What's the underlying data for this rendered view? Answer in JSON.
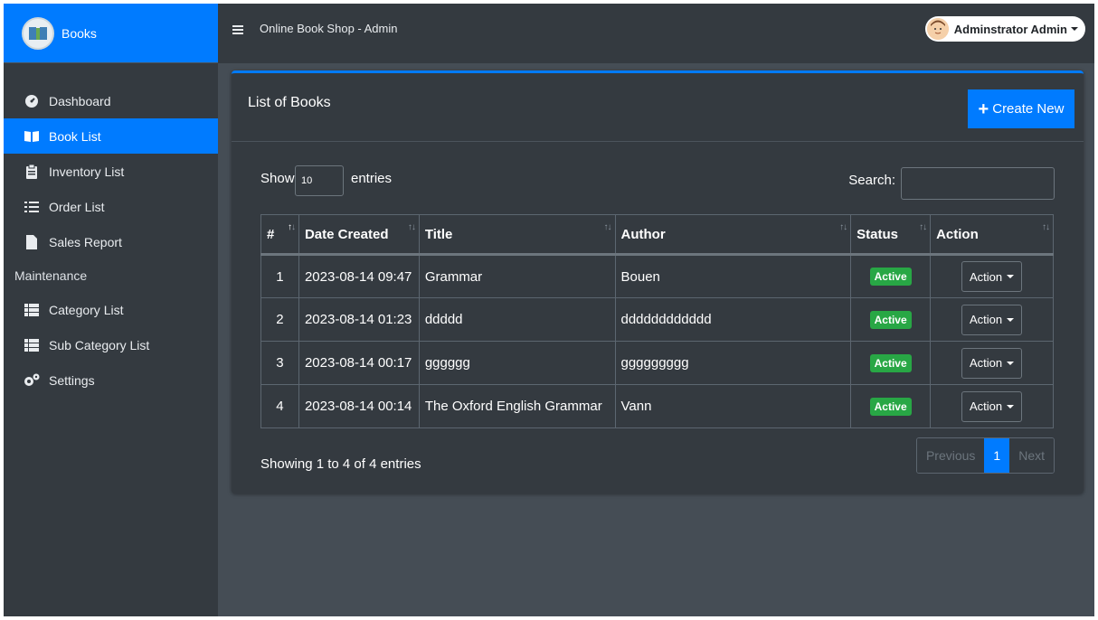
{
  "sidebar": {
    "brand": "Books",
    "items": [
      {
        "label": "Dashboard"
      },
      {
        "label": "Book List"
      },
      {
        "label": "Inventory List"
      },
      {
        "label": "Order List"
      },
      {
        "label": "Sales Report"
      }
    ],
    "section_header": "Maintenance",
    "maintenance_items": [
      {
        "label": "Category List"
      },
      {
        "label": "Sub Category List"
      },
      {
        "label": "Settings"
      }
    ]
  },
  "topbar": {
    "title": "Online Book Shop - Admin",
    "user_name": "Adminstrator Admin"
  },
  "card": {
    "title": "List of Books",
    "create_label": "Create New",
    "show_label": "Show",
    "entries_value": "10",
    "entries_label": "entries",
    "search_label": "Search:",
    "search_value": ""
  },
  "table": {
    "columns": [
      "#",
      "Date Created",
      "Title",
      "Author",
      "Status",
      "Action"
    ],
    "rows": [
      {
        "num": "1",
        "date": "2023-08-14 09:47",
        "title": "Grammar",
        "author": "Bouen",
        "status": "Active",
        "action": "Action"
      },
      {
        "num": "2",
        "date": "2023-08-14 01:23",
        "title": "ddddd",
        "author": "dddddddddddd",
        "status": "Active",
        "action": "Action"
      },
      {
        "num": "3",
        "date": "2023-08-14 00:17",
        "title": "gggggg",
        "author": "ggggggggg",
        "status": "Active",
        "action": "Action"
      },
      {
        "num": "4",
        "date": "2023-08-14 00:14",
        "title": "The Oxford English Grammar",
        "author": "Vann",
        "status": "Active",
        "action": "Action"
      }
    ]
  },
  "footer": {
    "info": "Showing 1 to 4 of 4 entries",
    "previous": "Previous",
    "page": "1",
    "next": "Next"
  },
  "colors": {
    "accent": "#007bff",
    "sidebar_bg": "#343a40",
    "content_bg": "#454d55",
    "status_active": "#28a745"
  }
}
